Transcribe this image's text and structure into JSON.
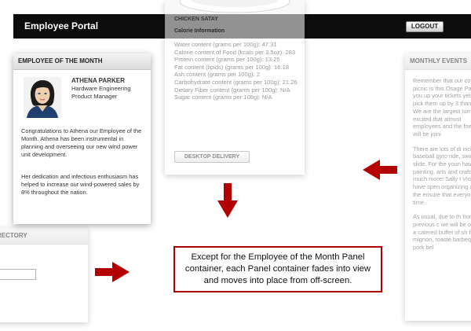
{
  "header": {
    "title": "Employee Portal",
    "logout_label": "LOGOUT"
  },
  "employee_of_month": {
    "panel_title": "EMPLOYEE OF THE MONTH",
    "name": "ATHENA PARKER",
    "role_line1": "Hardware Engineering",
    "role_line2": "Product Manager",
    "paragraph1": "Congratulations to Athena our Employee of the Month. Athena has been instrumental in planning and overseeing our new wind power unit development.",
    "paragraph2": "Her dedication and infectious enthusiasm has helped to increase our wind-powered sales by 8% throughout the nation."
  },
  "nutrition": {
    "food_name": "CHICKEN SATAY",
    "section_label": "Calorie Information",
    "rows": [
      "Water content (grams per 100g): 47.31",
      "Calorie content of Food (kcals per 3.5oz): 283",
      "Protein content (grams per 100g): 13.25",
      "Fat content (lipids) (grams per 100g): 16.18",
      "Ash content (grams per 100g): 2",
      "Carbohydrate content (grams per 100g): 21.26",
      "Dietary Fiber content (grams per 100g): N/A",
      "Sugar content (grams per 100g): N/A"
    ],
    "button_label": "DESKTOP DELIVERY"
  },
  "directory": {
    "panel_title": "RECTORY"
  },
  "events": {
    "panel_title": "MONTHLY EVENTS",
    "paragraphs": [
      "Remember that our company picnic is this Osage Park. If you up your tickets yet p to pick them up by 3 than 3 PM. We are the largest turn out excited that almost employees and the friends will be joini",
      "There are lots of di including, baseball gyro ride, swimmin slide. For the youn have face painting, arts and crafts boo much more! Sally I Violet P. have spen organizing all of the ensure that everyo great time.",
      "As usual, due to th from our previous c we will be offering a catered buffet of sh filet mignon, roaste barbeque pork bel"
    ]
  },
  "callout": {
    "text": "Except for the Employee of the Month Panel container, each Panel container fades into view and moves into place from off-screen."
  },
  "colors": {
    "arrow": "#b30000",
    "topbar": "#0d0d0d"
  }
}
